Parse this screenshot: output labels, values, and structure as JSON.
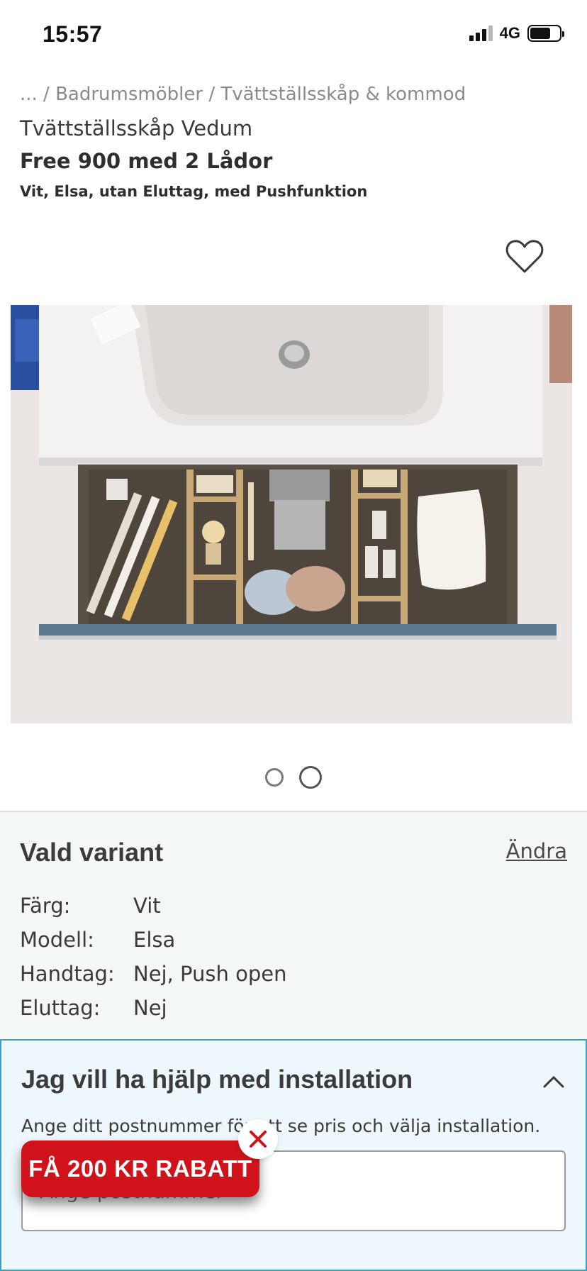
{
  "status": {
    "time": "15:57",
    "network": "4G",
    "battery_level": 0.7
  },
  "breadcrumb": {
    "ellipsis": "...",
    "separator": " / ",
    "category": "Badrumsmöbler",
    "subcategory": "Tvättställsskåp & kommod"
  },
  "product": {
    "brand_line": "Tvättställsskåp Vedum",
    "name": "Free 900 med 2 Lådor",
    "subtitle": "Vit, Elsa, utan Eluttag, med Pushfunktion"
  },
  "gallery": {
    "total_images": 2,
    "active_index": 1
  },
  "variant": {
    "title": "Vald variant",
    "change_label": "Ändra",
    "rows": [
      {
        "key": "Färg:",
        "value": "Vit"
      },
      {
        "key": "Modell:",
        "value": "Elsa"
      },
      {
        "key": "Handtag:",
        "value": "Nej, Push open"
      },
      {
        "key": "Eluttag:",
        "value": "Nej"
      }
    ]
  },
  "installation": {
    "title": "Jag vill ha hjälp med installation",
    "description": "Ange ditt postnummer för att se pris och välja installation.",
    "postal_placeholder": "Ange postnummer"
  },
  "promo": {
    "label": "FÅ 200 KR RABATT",
    "color": "#d0131b"
  },
  "colors": {
    "accent_border": "#3aa0c6",
    "variant_bg": "#f3f7f5",
    "install_bg": "#eef7fb"
  }
}
